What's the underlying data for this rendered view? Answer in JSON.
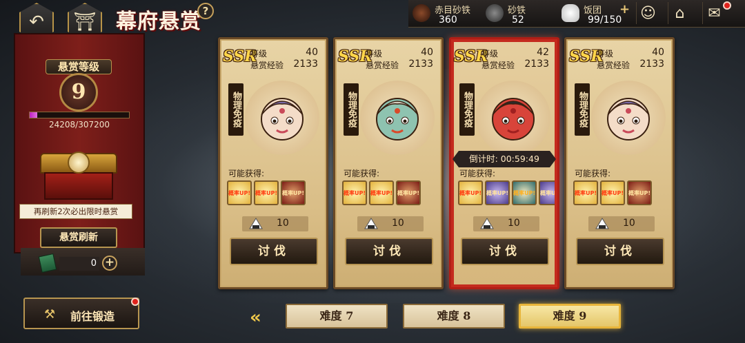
{
  "header": {
    "title": "幕府悬赏",
    "help": "?"
  },
  "resources": [
    {
      "label": "赤目砂铁",
      "value": "360"
    },
    {
      "label": "砂铁",
      "value": "52"
    },
    {
      "label": "饭团",
      "value": "99/150"
    }
  ],
  "rank": {
    "title": "悬赏等级",
    "level": "9",
    "xp_text": "24208/307200",
    "xp_fraction": 0.079
  },
  "refresh": {
    "note": "再刷新2次必出限时悬赏",
    "button": "悬赏刷新",
    "ticket_count": "0"
  },
  "forge": {
    "label": "前往锻造"
  },
  "labels": {
    "level": "等级",
    "exp": "悬赏经验",
    "possible": "可能获得:",
    "fight": "讨伐",
    "trait": "物理免疫",
    "reward_tag": "概率UP!"
  },
  "cards": [
    {
      "rarity": "SSR",
      "level": "40",
      "exp": "2133",
      "cost": "10",
      "timer": null,
      "active": false
    },
    {
      "rarity": "SSR",
      "level": "40",
      "exp": "2133",
      "cost": "10",
      "timer": null,
      "active": false
    },
    {
      "rarity": "SSR",
      "level": "42",
      "exp": "2133",
      "cost": "10",
      "timer": "倒计时: 00:59:49",
      "active": true
    },
    {
      "rarity": "SSR",
      "level": "40",
      "exp": "2133",
      "cost": "10",
      "timer": null,
      "active": false
    }
  ],
  "difficulty_tabs": [
    {
      "label": "难度 7",
      "selected": false
    },
    {
      "label": "难度 8",
      "selected": false
    },
    {
      "label": "难度 9",
      "selected": true
    }
  ],
  "colors": {
    "accent": "#e8b53a",
    "active_border": "#b01e16",
    "panel": "#7e1f1a"
  }
}
